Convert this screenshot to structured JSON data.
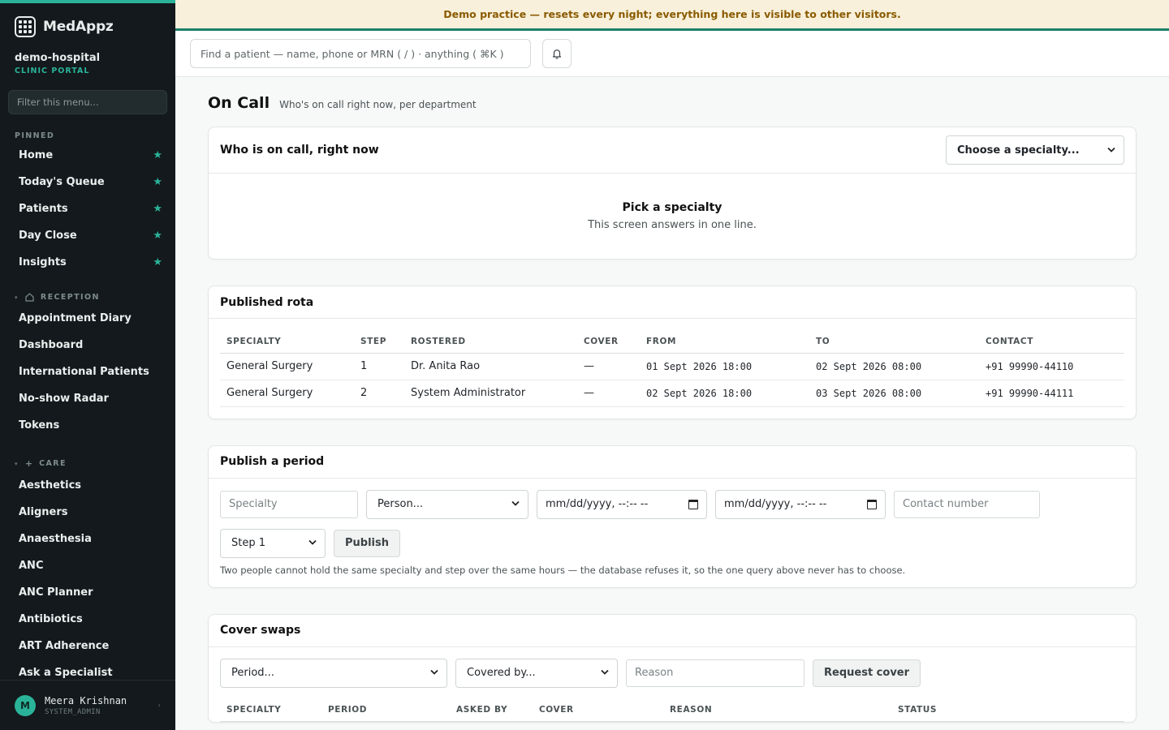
{
  "app": {
    "name": "MedAppz"
  },
  "org": {
    "name": "demo-hospital",
    "subtitle": "CLINIC PORTAL"
  },
  "sidebar": {
    "filter_placeholder": "Filter this menu...",
    "pinned_label": "PINNED",
    "pinned": [
      {
        "label": "Home"
      },
      {
        "label": "Today's Queue"
      },
      {
        "label": "Patients"
      },
      {
        "label": "Day Close"
      },
      {
        "label": "Insights"
      }
    ],
    "reception_label": "RECEPTION",
    "reception": [
      {
        "label": "Appointment Diary"
      },
      {
        "label": "Dashboard"
      },
      {
        "label": "International Patients"
      },
      {
        "label": "No-show Radar"
      },
      {
        "label": "Tokens"
      }
    ],
    "care_label": "CARE",
    "care": [
      {
        "label": "Aesthetics"
      },
      {
        "label": "Aligners"
      },
      {
        "label": "Anaesthesia"
      },
      {
        "label": "ANC"
      },
      {
        "label": "ANC Planner"
      },
      {
        "label": "Antibiotics"
      },
      {
        "label": "ART Adherence"
      },
      {
        "label": "Ask a Specialist"
      }
    ],
    "star_glyph": "★"
  },
  "user": {
    "initial": "M",
    "name": "Meera Krishnan",
    "role": "SYSTEM_ADMIN"
  },
  "banner": {
    "text": "Demo practice — resets every night; everything here is visible to other visitors."
  },
  "search": {
    "placeholder": "Find a patient — name, phone or MRN ( / ) · anything ( ⌘K )"
  },
  "page": {
    "title": "On Call",
    "subtitle": "Who's on call right now, per department"
  },
  "now": {
    "title": "Who is on call, right now",
    "select_value": "Choose a specialty...",
    "empty_title": "Pick a specialty",
    "empty_sub": "This screen answers in one line."
  },
  "rota": {
    "title": "Published rota",
    "columns": [
      "SPECIALTY",
      "STEP",
      "ROSTERED",
      "COVER",
      "FROM",
      "TO",
      "CONTACT"
    ],
    "rows": [
      {
        "specialty": "General Surgery",
        "step": "1",
        "rostered": "Dr. Anita Rao",
        "cover": "—",
        "from": "01 Sept 2026 18:00",
        "to": "02 Sept 2026 08:00",
        "contact": "+91 99990-44110"
      },
      {
        "specialty": "General Surgery",
        "step": "2",
        "rostered": "System Administrator",
        "cover": "—",
        "from": "02 Sept 2026 18:00",
        "to": "03 Sept 2026 08:00",
        "contact": "+91 99990-44111"
      }
    ]
  },
  "publish": {
    "title": "Publish a period",
    "specialty_placeholder": "Specialty",
    "person_value": "Person...",
    "from_value": "mm/dd/yyyy, --:-- --",
    "to_value": "mm/dd/yyyy, --:-- --",
    "contact_placeholder": "Contact number",
    "step_value": "Step 1",
    "button": "Publish",
    "help": "Two people cannot hold the same specialty and step over the same hours — the database refuses it, so the one query above never has to choose."
  },
  "swaps": {
    "title": "Cover swaps",
    "period_value": "Period...",
    "covered_value": "Covered by...",
    "reason_placeholder": "Reason",
    "button": "Request cover",
    "columns": [
      "SPECIALTY",
      "PERIOD",
      "ASKED BY",
      "COVER",
      "REASON",
      "STATUS"
    ]
  }
}
